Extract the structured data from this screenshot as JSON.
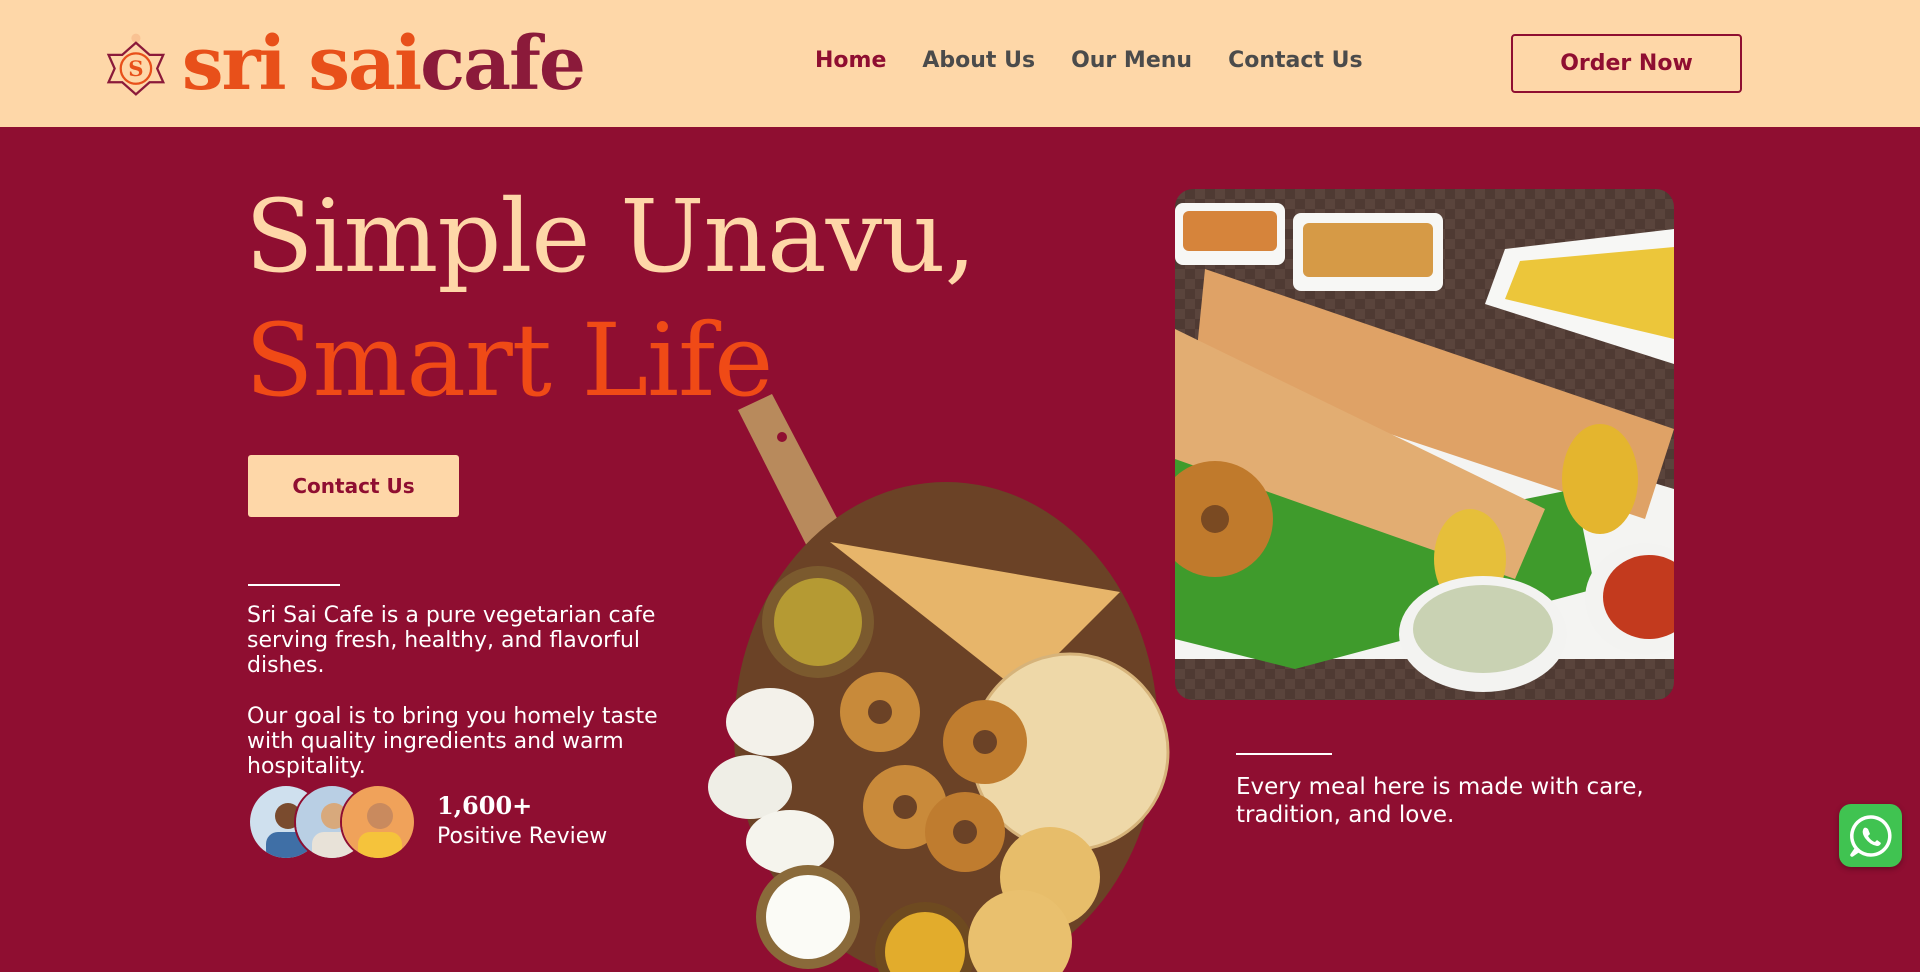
{
  "brand": {
    "name_part1": "sri sai",
    "name_part2": "cafe",
    "primary": "#8f0e31",
    "cream": "#fed7a8",
    "accent": "#f04a16"
  },
  "nav": {
    "items": [
      {
        "label": "Home",
        "active": true
      },
      {
        "label": "About Us"
      },
      {
        "label": "Our Menu"
      },
      {
        "label": "Contact Us"
      }
    ]
  },
  "header": {
    "order_label": "Order Now"
  },
  "hero": {
    "title_line1": "Simple Unavu,",
    "title_line2": "Smart Life",
    "cta_label": "Contact Us",
    "para1": "Sri Sai Cafe is a pure vegetarian cafe serving fresh, healthy, and flavorful dishes.",
    "para2": "Our goal is to bring you homely taste with quality ingredients and warm hospitality.",
    "review_count": "1,600+",
    "review_label": "Positive Review",
    "side_text": "Every meal here is made with care, tradition, and love."
  },
  "icons": {
    "logo": "lotus-s-emblem",
    "whatsapp": "whatsapp-icon"
  }
}
